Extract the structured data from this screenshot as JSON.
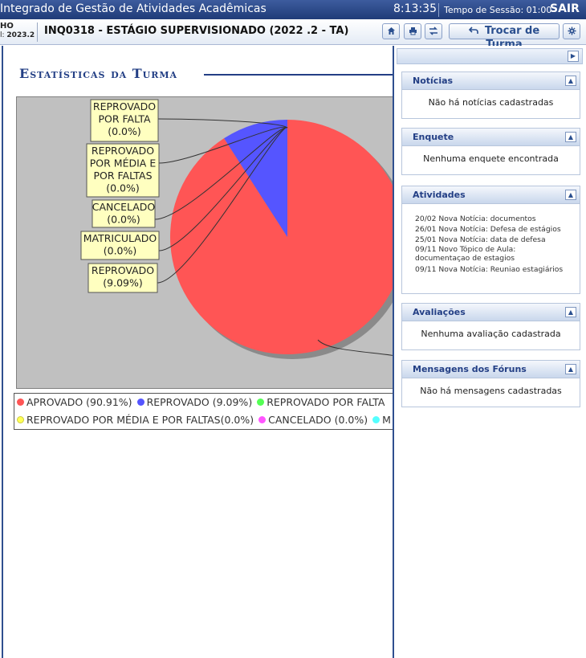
{
  "topbar": {
    "app_title": "Integrado de Gestão de Atividades Acadêmicas",
    "clock": "8:13:35",
    "session": "Tempo de Sessão: 01:00",
    "logout": "SAIR"
  },
  "header": {
    "user_line1": "HO",
    "user_line2_prefix": "l:",
    "user_line2_period": "2023.2",
    "course_title": "INQ0318 - ESTÁGIO SUPERVISIONADO (2022 .2 - TA)",
    "trocar_turma_label": "Trocar de Turma",
    "icons": [
      "home-icon",
      "print-icon",
      "switch-icon",
      "back-arrow-icon",
      "gear-icon"
    ]
  },
  "main": {
    "page_title": "Estatísticas da Turma"
  },
  "chart_data": {
    "type": "pie",
    "slices": [
      {
        "label": "APROVADO",
        "value": 90.91,
        "color": "#ff5555"
      },
      {
        "label": "REPROVADO",
        "value": 9.09,
        "color": "#5555ff"
      },
      {
        "label": "REPROVADO POR FALTA",
        "value": 0.0,
        "color": "#55ff55"
      },
      {
        "label": "REPROVADO POR MÉDIA E POR FALTAS",
        "value": 0.0,
        "color": "#ffff55"
      },
      {
        "label": "CANCELADO",
        "value": 0.0,
        "color": "#ff55ff"
      },
      {
        "label": "MATRICULADO",
        "value": 0.0,
        "color": "#55ffff"
      }
    ],
    "callouts": [
      {
        "lines": [
          "REPROVADO",
          "POR FALTA",
          "(0.0%)"
        ]
      },
      {
        "lines": [
          "REPROVADO",
          "POR MÉDIA E",
          "POR FALTAS",
          "(0.0%)"
        ]
      },
      {
        "lines": [
          "CANCELADO",
          "(0.0%)"
        ]
      },
      {
        "lines": [
          "MATRICULADO",
          "(0.0%)"
        ]
      },
      {
        "lines": [
          "REPROVADO",
          "(9.09%)"
        ]
      }
    ],
    "legend": {
      "row1": [
        "APROVADO (90.91%)",
        "REPROVADO (9.09%)",
        "REPROVADO POR FALTA"
      ],
      "row2": [
        "REPROVADO POR MÉDIA E POR FALTAS(0.0%)",
        "CANCELADO (0.0%)",
        "M"
      ]
    },
    "background": "#c0c0c0"
  },
  "sidebar": {
    "panels": [
      {
        "title": "Notícias",
        "body": "Não há notícias cadastradas"
      },
      {
        "title": "Enquete",
        "body": "Nenhuma enquete encontrada"
      },
      {
        "title": "Atividades",
        "items": [
          {
            "date": "20/02",
            "text": "Nova Notícia: documentos"
          },
          {
            "date": "26/01",
            "text": "Nova Notícia: Defesa de estágios"
          },
          {
            "date": "25/01",
            "text": "Nova Notícia: data de defesa"
          },
          {
            "date": "09/11",
            "text": "Novo Tópico de Aula:",
            "text2": "documentaçao de estagios"
          },
          {
            "date": "09/11",
            "text": "Nova Notícia: Reuniao estagiários"
          }
        ]
      },
      {
        "title": "Avaliações",
        "body": "Nenhuma avaliação cadastrada"
      },
      {
        "title": "Mensagens dos Fóruns",
        "body": "Não há mensagens cadastradas"
      }
    ]
  }
}
